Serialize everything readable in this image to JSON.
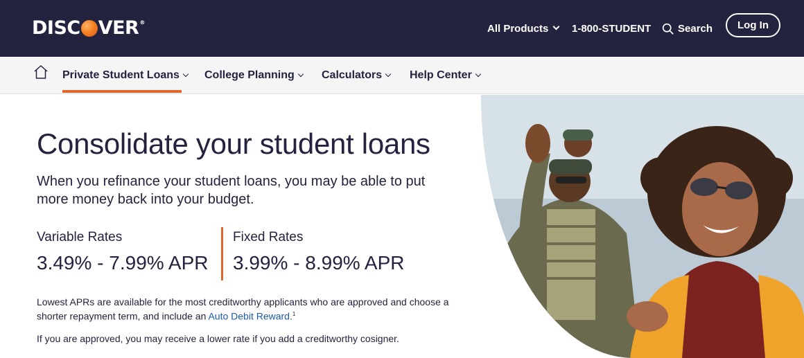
{
  "brand": {
    "logo_text_pre": "DISC",
    "logo_text_post": "VER",
    "logo_tm": "®",
    "colors": {
      "navy": "#23233f",
      "orange": "#e0672b",
      "link": "#1f5aa6"
    }
  },
  "top_nav": {
    "products_label": "All Products",
    "phone_label": "1-800-STUDENT",
    "search_label": "Search",
    "login_label": "Log In"
  },
  "sub_nav": {
    "items": [
      {
        "label": "Private Student Loans",
        "active": true
      },
      {
        "label": "College Planning"
      },
      {
        "label": "Calculators"
      },
      {
        "label": "Help Center"
      }
    ]
  },
  "hero": {
    "title": "Consolidate your student loans",
    "subtitle": "When you refinance your student loans, you may be able to put more money back into your budget.",
    "variable": {
      "label": "Variable Rates",
      "value": "3.49% - 7.99% APR"
    },
    "fixed": {
      "label": "Fixed Rates",
      "value": "3.99% - 8.99% APR"
    },
    "disclaimer_text": "Lowest APRs are available for the most creditworthy applicants who are approved and choose a shorter repayment term, and include an ",
    "disclaimer_link": "Auto Debit Reward.",
    "disclaimer_footnote": "1",
    "cosigner_text": "If you are approved, you may receive a lower rate if you add a creditworthy cosigner."
  },
  "icons": {
    "home": "home-icon",
    "search": "search-icon",
    "chevron": "chevron-down-icon"
  }
}
